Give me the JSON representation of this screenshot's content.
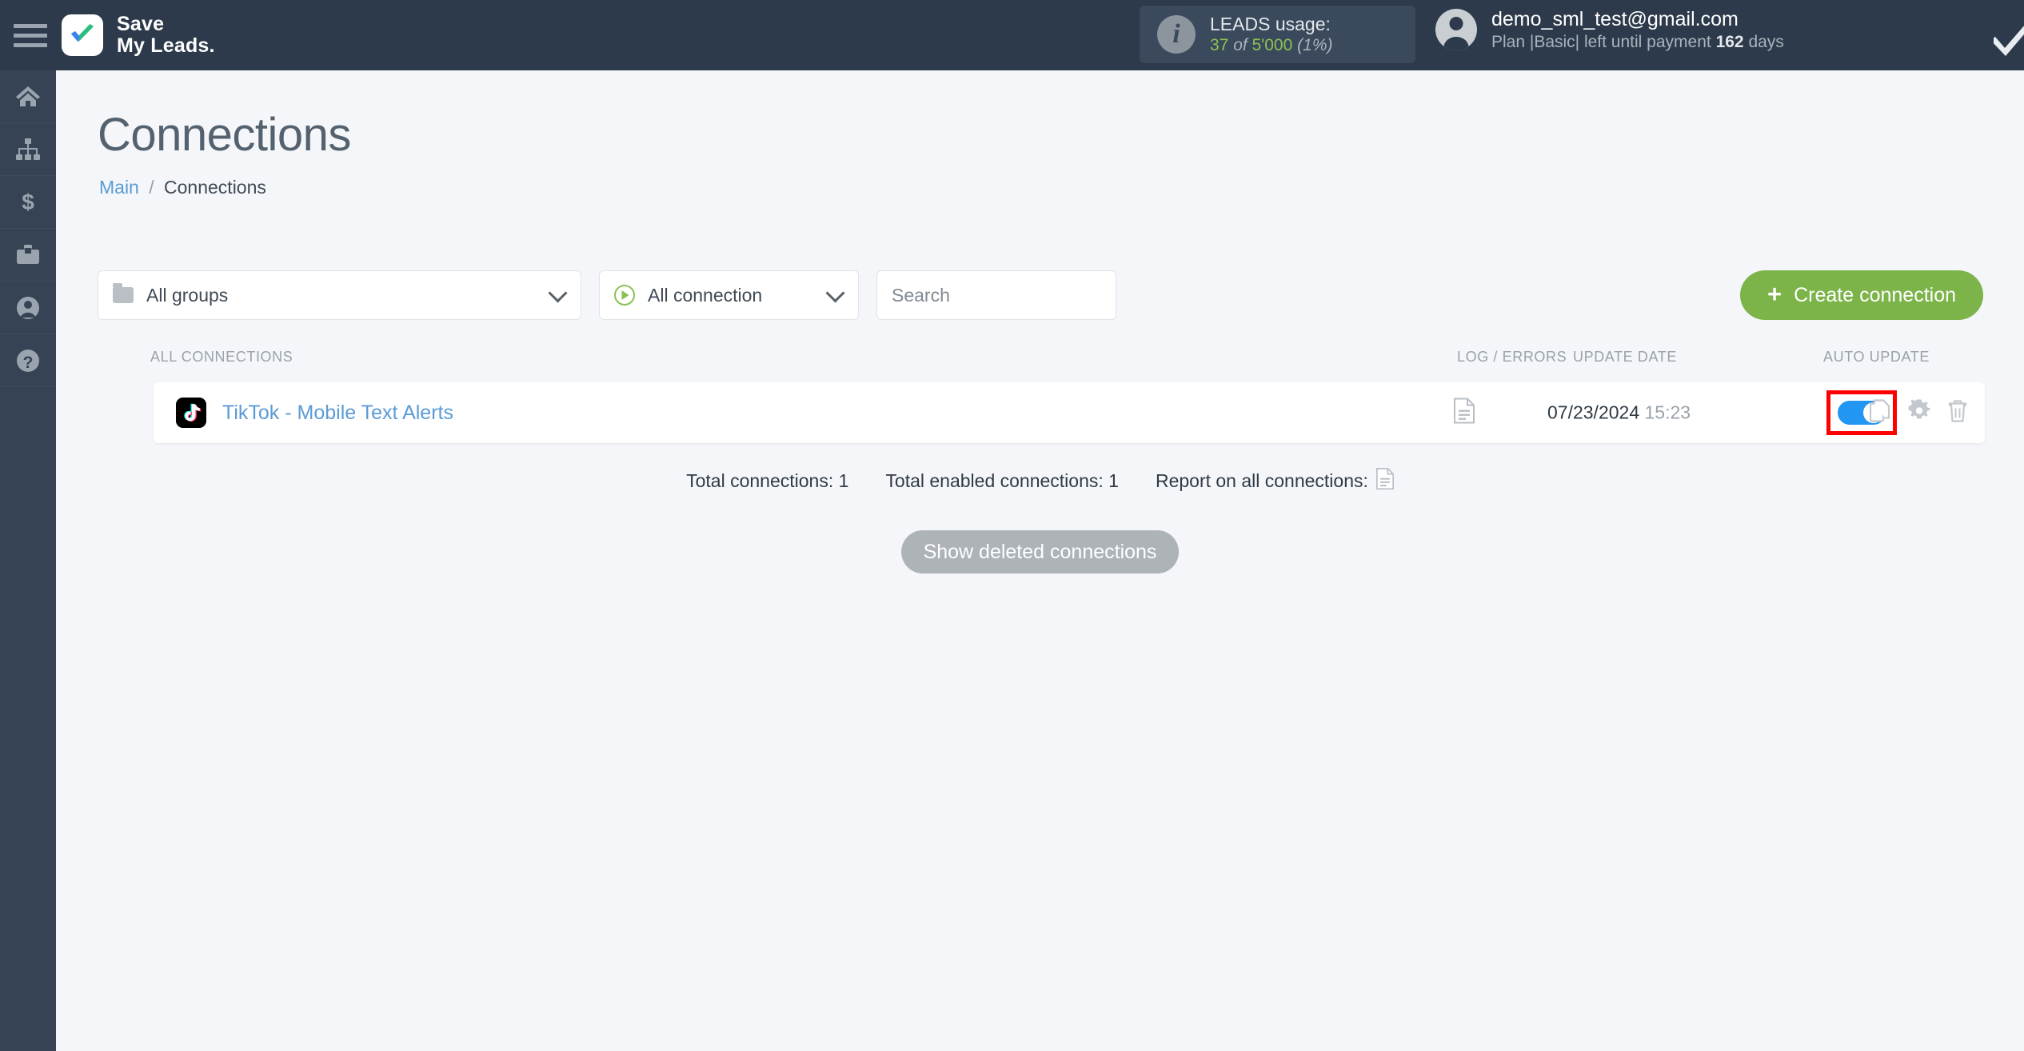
{
  "header": {
    "menu_icon": "hamburger-menu-icon",
    "brand_line1": "Save",
    "brand_line2": "My Leads.",
    "leads": {
      "icon": "info-icon",
      "title": "LEADS usage:",
      "used": "37",
      "of_word": "of",
      "total": "5'000",
      "percent": "(1%)"
    },
    "account": {
      "avatar_icon": "user-avatar-icon",
      "email": "demo_sml_test@gmail.com",
      "plan_prefix": "Plan |Basic| left until payment",
      "days_value": "162",
      "days_suffix": "days"
    }
  },
  "sidebar": {
    "items": [
      {
        "name": "home",
        "icon": "home-icon"
      },
      {
        "name": "connections",
        "icon": "sitemap-icon"
      },
      {
        "name": "billing",
        "icon": "dollar-icon"
      },
      {
        "name": "business",
        "icon": "briefcase-icon"
      },
      {
        "name": "profile",
        "icon": "user-circle-icon"
      },
      {
        "name": "help",
        "icon": "question-circle-icon"
      }
    ]
  },
  "page": {
    "title": "Connections",
    "breadcrumb": {
      "root": "Main",
      "separator": "/",
      "current": "Connections"
    }
  },
  "filters": {
    "groups": {
      "icon": "folder-icon",
      "value": "All groups",
      "chevron": "chevron-down-icon"
    },
    "connection": {
      "icon": "play-circle-icon",
      "value": "All connection",
      "chevron": "chevron-down-icon"
    },
    "search": {
      "value": "",
      "placeholder": "Search"
    },
    "create_button": {
      "plus": "+",
      "label": "Create connection"
    }
  },
  "table": {
    "columns": {
      "name": "ALL CONNECTIONS",
      "log": "LOG / ERRORS",
      "date": "UPDATE DATE",
      "auto": "AUTO UPDATE"
    },
    "rows": [
      {
        "logo": "tiktok-logo-icon",
        "title": "TikTok - Mobile Text Alerts",
        "log_icon": "document-log-icon",
        "date": "07/23/2024",
        "time": "15:23",
        "auto_update_enabled": true,
        "actions": {
          "copy": "copy-icon",
          "settings": "gear-icon",
          "delete": "trash-icon"
        }
      }
    ]
  },
  "totals": {
    "total_connections": "Total connections: 1",
    "total_enabled": "Total enabled connections: 1",
    "report_label": "Report on all connections:",
    "report_icon": "document-report-icon"
  },
  "show_deleted_button": "Show deleted connections",
  "colors": {
    "header_bg": "#2c3a4b",
    "sidebar_bg": "#354354",
    "page_bg": "#f4f6fa",
    "accent_green": "#7cb44a",
    "link_blue": "#5b9bd5",
    "toggle_blue": "#2196f3",
    "highlight_red": "#ff0000",
    "muted_gray": "#9aa2ab"
  }
}
